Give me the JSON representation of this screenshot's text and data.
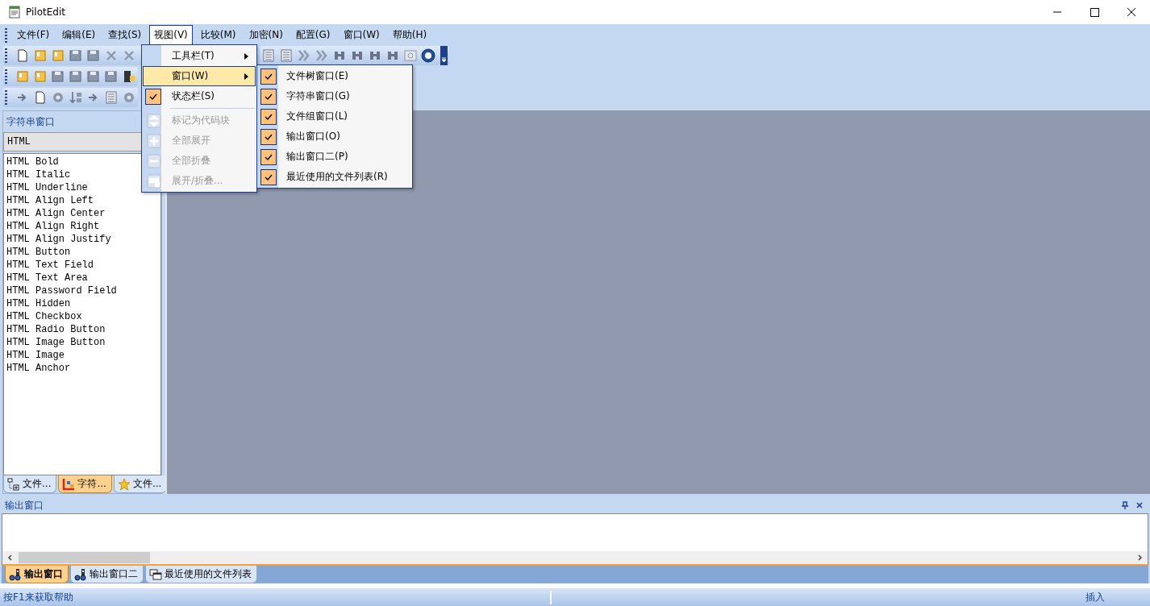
{
  "window": {
    "title": "PilotEdit"
  },
  "menu_bar": [
    {
      "label": "文件(F)",
      "selected": false
    },
    {
      "label": "编辑(E)",
      "selected": false
    },
    {
      "label": "查找(S)",
      "selected": false
    },
    {
      "label": "视图(V)",
      "selected": true
    },
    {
      "label": "比较(M)",
      "selected": false
    },
    {
      "label": "加密(N)",
      "selected": false
    },
    {
      "label": "配置(G)",
      "selected": false
    },
    {
      "label": "窗口(W)",
      "selected": false
    },
    {
      "label": "帮助(H)",
      "selected": false
    }
  ],
  "view_menu": [
    {
      "kind": "submenu",
      "label": "工具栏(T)",
      "selected": false
    },
    {
      "kind": "submenu",
      "label": "窗口(W)",
      "selected": true
    },
    {
      "kind": "check",
      "label": "状态栏(S)",
      "checked": true
    },
    {
      "kind": "separator"
    },
    {
      "kind": "command",
      "label": "标记为代码块",
      "disabled": true
    },
    {
      "kind": "command",
      "label": "全部展开",
      "disabled": true
    },
    {
      "kind": "command",
      "label": "全部折叠",
      "disabled": true
    },
    {
      "kind": "command",
      "label": "展开/折叠...",
      "disabled": true
    }
  ],
  "window_submenu": [
    {
      "label": "文件树窗口(E)",
      "checked": true
    },
    {
      "label": "字符串窗口(G)",
      "checked": true
    },
    {
      "label": "文件组窗口(L)",
      "checked": true
    },
    {
      "label": "输出窗口(O)",
      "checked": true
    },
    {
      "label": "输出窗口二(P)",
      "checked": true
    },
    {
      "label": "最近使用的文件列表(R)",
      "checked": true
    }
  ],
  "string_panel": {
    "title": "字符串窗口",
    "category": "HTML",
    "items": [
      "HTML Bold",
      "HTML Italic",
      "HTML Underline",
      "HTML Align Left",
      "HTML Align Center",
      "HTML Align Right",
      "HTML Align Justify",
      "HTML Button",
      "HTML Text Field",
      "HTML Text Area",
      "HTML Password Field",
      "HTML Hidden",
      "HTML Checkbox",
      "HTML Radio Button",
      "HTML Image Button",
      "HTML Image",
      "HTML Anchor"
    ],
    "tabs": [
      {
        "label": "文件...",
        "selected": false
      },
      {
        "label": "字符...",
        "selected": true
      },
      {
        "label": "文件...",
        "selected": false
      }
    ]
  },
  "output_panel": {
    "title": "输出窗口",
    "tabs": [
      {
        "label": "输出窗口",
        "selected": true
      },
      {
        "label": "输出窗口二",
        "selected": false
      },
      {
        "label": "最近使用的文件列表",
        "selected": false
      }
    ]
  },
  "status_bar": {
    "message": "按F1来获取帮助",
    "mode": "插入"
  }
}
